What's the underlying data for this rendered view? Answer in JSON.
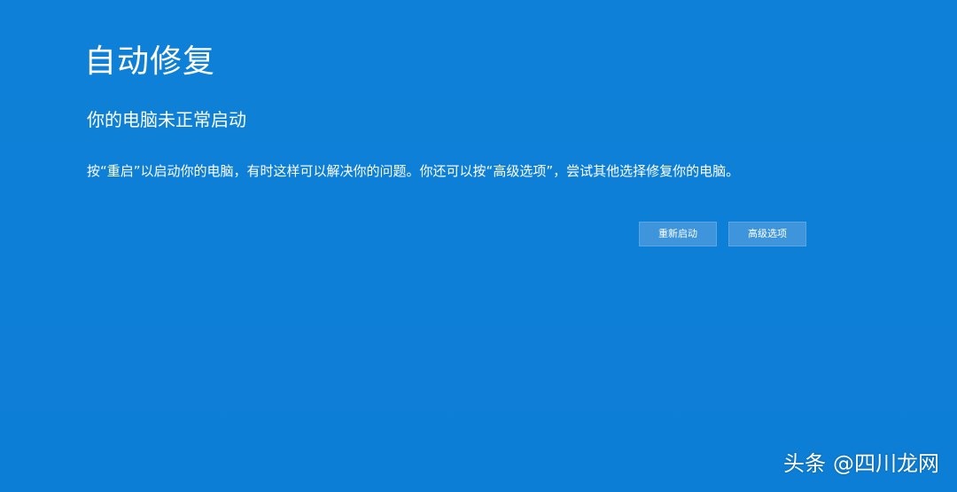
{
  "screen": {
    "title": "自动修复",
    "subtitle": "你的电脑未正常启动",
    "message": "按“重启”以启动你的电脑，有时这样可以解决你的问题。你还可以按“高级选项”，尝试其他选择修复你的电脑。",
    "buttons": {
      "restart_label": "重新启动",
      "advanced_label": "高级选项"
    }
  },
  "watermark": {
    "source": "头条",
    "handle": "@四川龙网"
  },
  "colors": {
    "background": "#0e7fd6",
    "button_fill": "#3e95db",
    "text": "#ffffff"
  }
}
